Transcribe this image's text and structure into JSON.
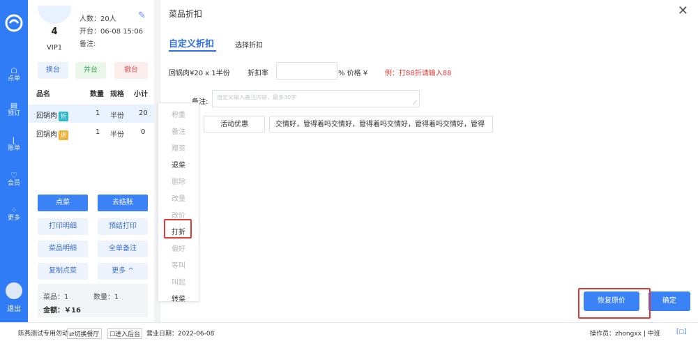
{
  "sidebar": {
    "items": [
      {
        "icon": "order-icon",
        "label": "点单"
      },
      {
        "icon": "reserve-icon",
        "label": "预订"
      },
      {
        "icon": "bill-icon",
        "label": "账单"
      },
      {
        "icon": "member-icon",
        "label": "会员"
      },
      {
        "icon": "more-icon",
        "label": "更多"
      }
    ],
    "exit_label": "退出"
  },
  "order": {
    "table_number": "4",
    "table_name": "VIP1",
    "people": "人数：20人",
    "open_time": "开台：06-08 15:06",
    "note": "备注:",
    "buttons": {
      "change_table": "换台",
      "merge_table": "并台",
      "cancel_table": "撤台"
    },
    "columns": [
      "品名",
      "数量",
      "规格",
      "小计"
    ],
    "rows": [
      {
        "name": "回锅肉",
        "tag": "折",
        "qty": "1",
        "spec": "半份",
        "subtotal": "20"
      },
      {
        "name": "回锅肉",
        "tag": "退",
        "qty": "1",
        "spec": "半份",
        "subtotal": "0"
      }
    ],
    "actions": {
      "order_dish": "点菜",
      "checkout": "去结账",
      "print_detail": "打印明细",
      "pre_print": "预结打印",
      "dish_detail": "菜品明细",
      "whole_note": "全单备注",
      "copy_dish": "复制点菜",
      "more": "更多 ^"
    },
    "summary": {
      "dishes": "菜品：1",
      "count": "数量：1",
      "amount": "金额：￥16"
    }
  },
  "context_menu": {
    "items": [
      {
        "label": "称重",
        "enabled": false
      },
      {
        "label": "备注",
        "enabled": false
      },
      {
        "label": "赠菜",
        "enabled": false
      },
      {
        "label": "退菜",
        "enabled": true
      },
      {
        "label": "删除",
        "enabled": false
      },
      {
        "label": "改量",
        "enabled": false
      },
      {
        "label": "改价",
        "enabled": false
      },
      {
        "label": "打折",
        "enabled": true
      },
      {
        "label": "偏好",
        "enabled": false
      },
      {
        "label": "等叫",
        "enabled": false
      },
      {
        "label": "叫起",
        "enabled": false
      },
      {
        "label": "转菜",
        "enabled": true
      }
    ]
  },
  "panel": {
    "title": "菜品折扣",
    "tab_custom": "自定义折扣",
    "tab_select": "选择折扣",
    "item_text": "回锅肉¥20 x 1半份",
    "rate_label": "折扣率",
    "rate_value": "",
    "percent_price": "%  价格 ¥",
    "example": "例：打88折请输入88",
    "note_label": "备注:",
    "note_placeholder": "自定义输入备注内容，最多30字",
    "options": [
      {
        "label": "活动优惠"
      },
      {
        "label": "交情好，管得着吗交情好，管得着吗交情好，管得着吗交情好，管得"
      }
    ],
    "restore_button": "恢复原价",
    "confirm_button": "确定"
  },
  "status_bar": {
    "store": "陈燕测试专用勿动",
    "switch_store": "⇄切换餐厅",
    "backend": "☐进入后台",
    "business_date": "营业日期：2022-06-08",
    "operator": "操作员：zhongxx | 中班"
  },
  "colors": {
    "primary": "#2f7cf6",
    "highlight": "#e53935",
    "example_text": "#e53935"
  }
}
